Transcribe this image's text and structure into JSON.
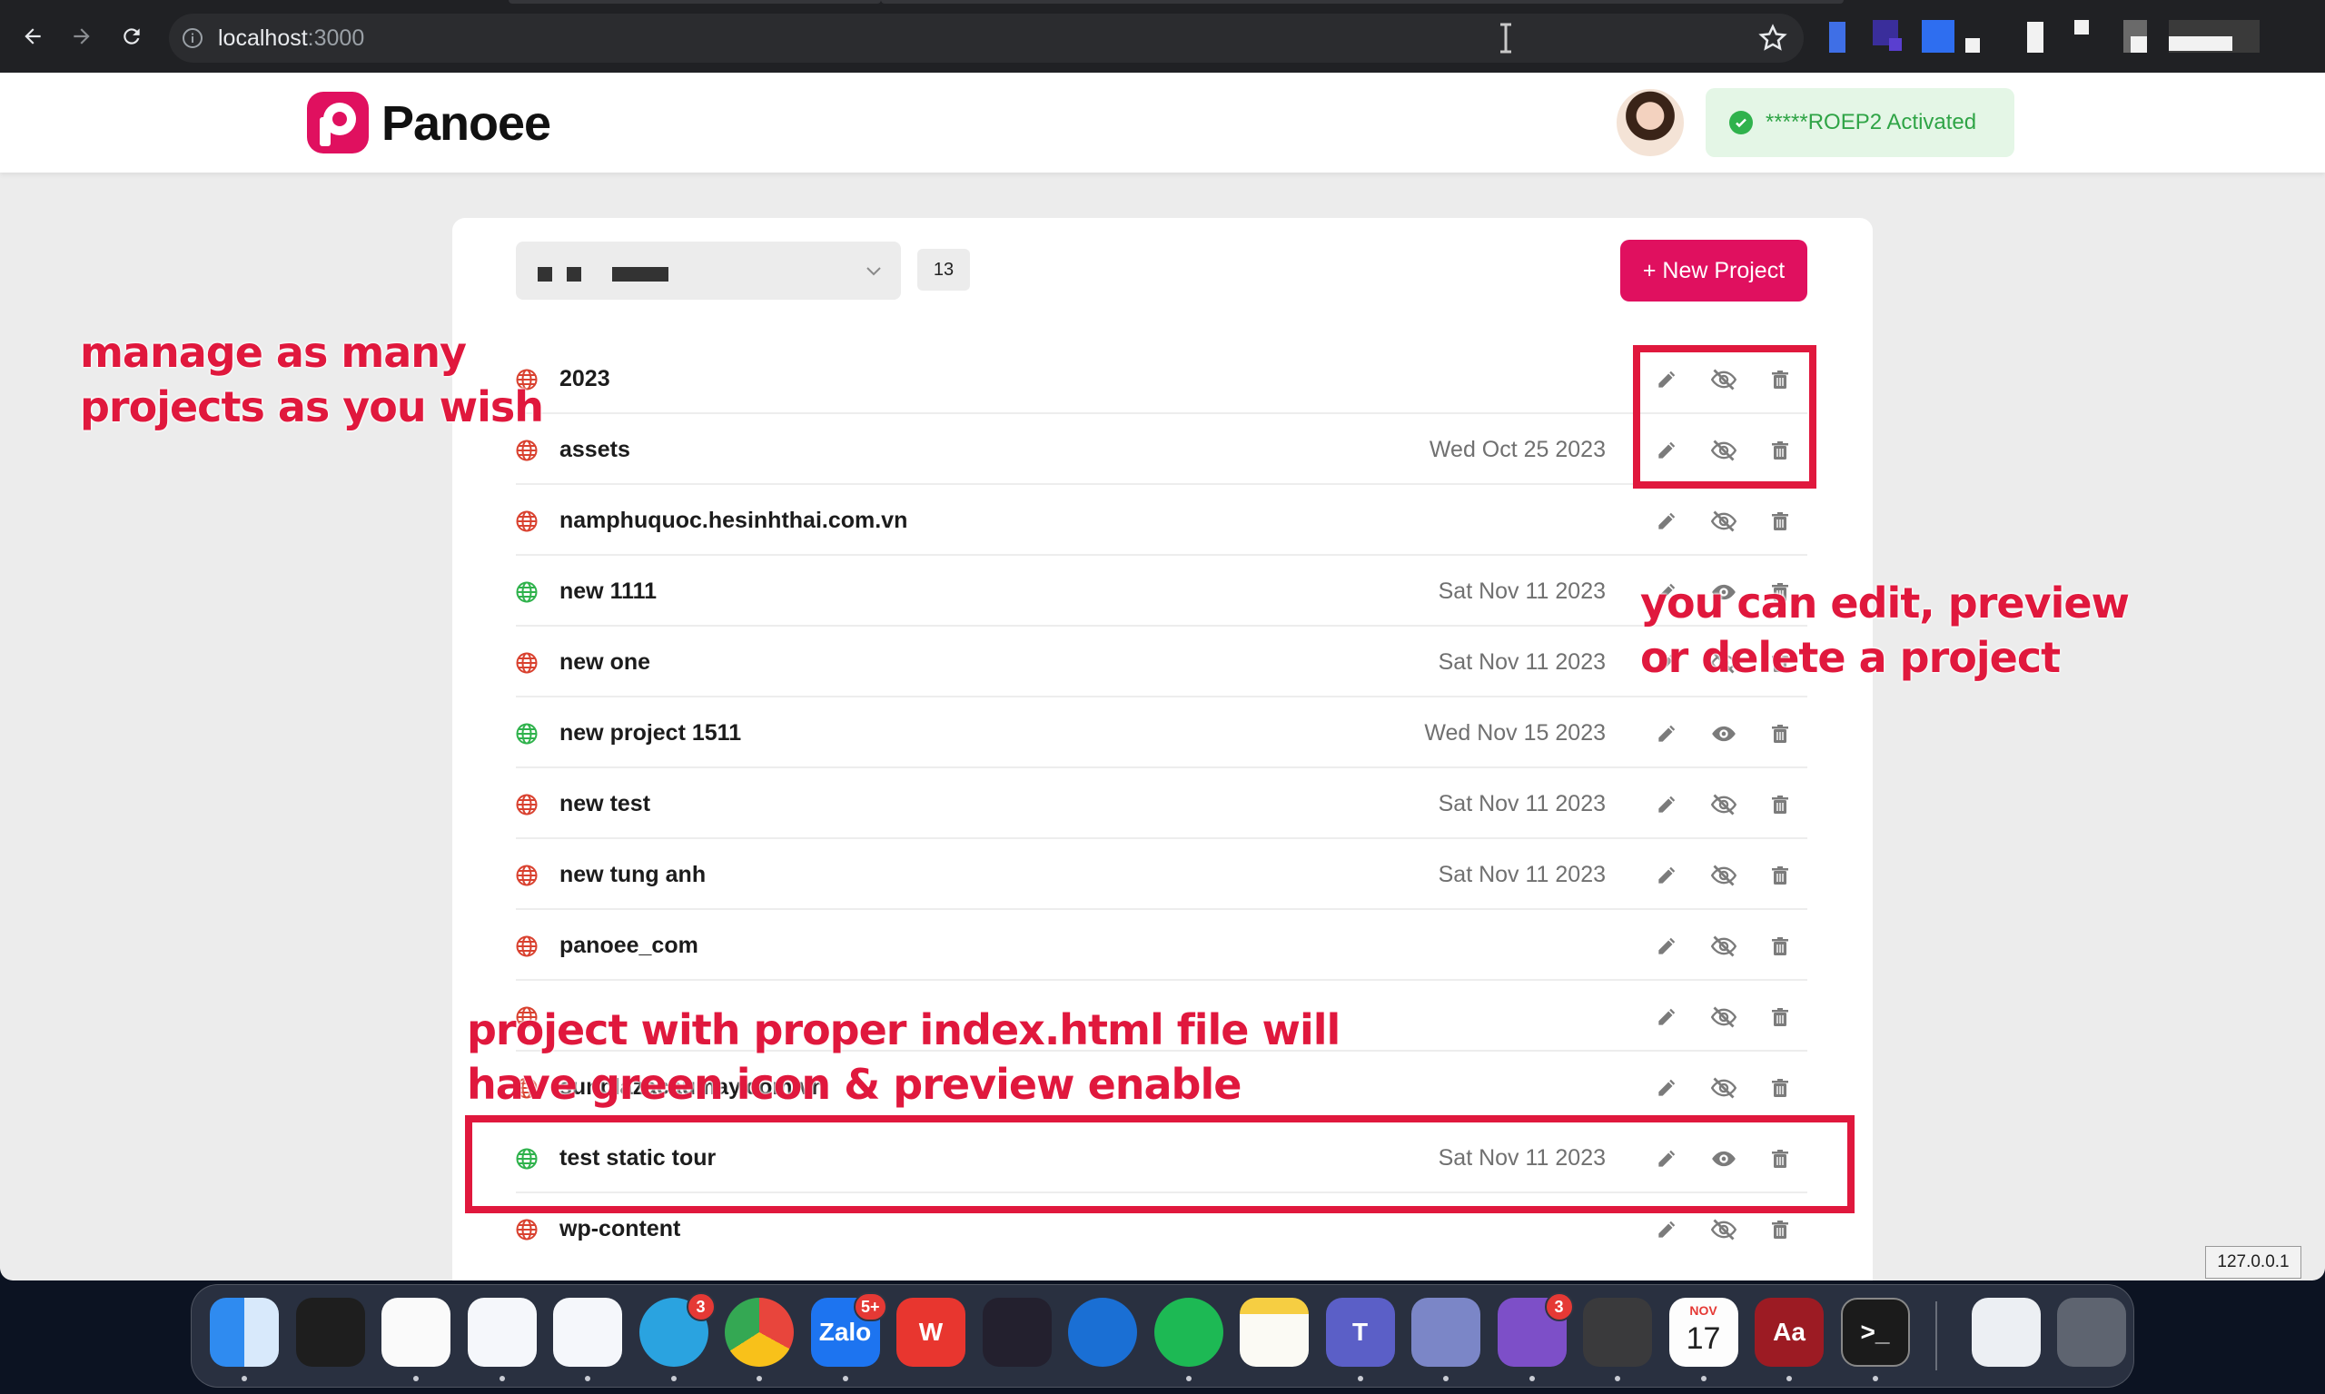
{
  "browser": {
    "url_host": "localhost",
    "url_port": ":3000",
    "ip_label": "127.0.0.1"
  },
  "app": {
    "brand": "Panoee",
    "license_text": "*****ROEP2 Activated",
    "project_count": "13",
    "new_project_label": "+ New Project",
    "colors": {
      "accent": "#e0105f",
      "ok_green": "#2fb24c",
      "error_red": "#d9412f",
      "annotation": "#e0183d"
    }
  },
  "projects": [
    {
      "name": "2023",
      "date": "",
      "status": "red",
      "preview": "disabled"
    },
    {
      "name": "assets",
      "date": "Wed Oct 25 2023",
      "status": "red",
      "preview": "disabled"
    },
    {
      "name": "namphuquoc.hesinhthai.com.vn",
      "date": "",
      "status": "red",
      "preview": "disabled"
    },
    {
      "name": "new 1111",
      "date": "Sat Nov 11 2023",
      "status": "green",
      "preview": "enabled"
    },
    {
      "name": "new one",
      "date": "Sat Nov 11 2023",
      "status": "red",
      "preview": "disabled"
    },
    {
      "name": "new project 1511",
      "date": "Wed Nov 15 2023",
      "status": "green",
      "preview": "enabled"
    },
    {
      "name": "new test",
      "date": "Sat Nov 11 2023",
      "status": "red",
      "preview": "disabled"
    },
    {
      "name": "new tung anh",
      "date": "Sat Nov 11 2023",
      "status": "red",
      "preview": "disabled"
    },
    {
      "name": "panoee_com",
      "date": "",
      "status": "red",
      "preview": "disabled"
    },
    {
      "name": "",
      "date": "",
      "status": "red",
      "preview": "disabled"
    },
    {
      "name": "sunplazacaumay.com.vn",
      "date": "",
      "status": "red",
      "preview": "disabled"
    },
    {
      "name": "test static tour",
      "date": "Sat Nov 11 2023",
      "status": "green",
      "preview": "enabled"
    },
    {
      "name": "wp-content",
      "date": "",
      "status": "red",
      "preview": "disabled"
    }
  ],
  "annotations": {
    "manage": "manage as many\nprojects as you wish",
    "actions": "you can edit, preview\nor delete a project",
    "green": "project with proper index.html file will\nhave green icon & preview enable"
  },
  "dock": {
    "apps": [
      {
        "name": "finder",
        "label": "",
        "badge": ""
      },
      {
        "name": "figma",
        "label": "",
        "badge": ""
      },
      {
        "name": "clickup",
        "label": "",
        "badge": ""
      },
      {
        "name": "todo",
        "label": "",
        "badge": ""
      },
      {
        "name": "vscode",
        "label": "",
        "badge": ""
      },
      {
        "name": "telegram",
        "label": "",
        "badge": "3"
      },
      {
        "name": "chrome",
        "label": "",
        "badge": ""
      },
      {
        "name": "zalo",
        "label": "Zalo",
        "badge": "5+"
      },
      {
        "name": "wps",
        "label": "W",
        "badge": ""
      },
      {
        "name": "obsidian",
        "label": "",
        "badge": ""
      },
      {
        "name": "browser",
        "label": "",
        "badge": ""
      },
      {
        "name": "spotify",
        "label": "",
        "badge": ""
      },
      {
        "name": "notes",
        "label": "",
        "badge": ""
      },
      {
        "name": "teams",
        "label": "T",
        "badge": ""
      },
      {
        "name": "transmit",
        "label": "",
        "badge": ""
      },
      {
        "name": "viber",
        "label": "",
        "badge": "3"
      },
      {
        "name": "calculator",
        "label": "",
        "badge": ""
      },
      {
        "name": "calendar",
        "label": "17",
        "badge": "",
        "month": "NOV"
      },
      {
        "name": "dictionary",
        "label": "Aa",
        "badge": ""
      },
      {
        "name": "terminal",
        "label": ">_",
        "badge": ""
      },
      {
        "name": "screenshot",
        "label": "",
        "badge": ""
      },
      {
        "name": "trash",
        "label": "",
        "badge": ""
      }
    ]
  }
}
